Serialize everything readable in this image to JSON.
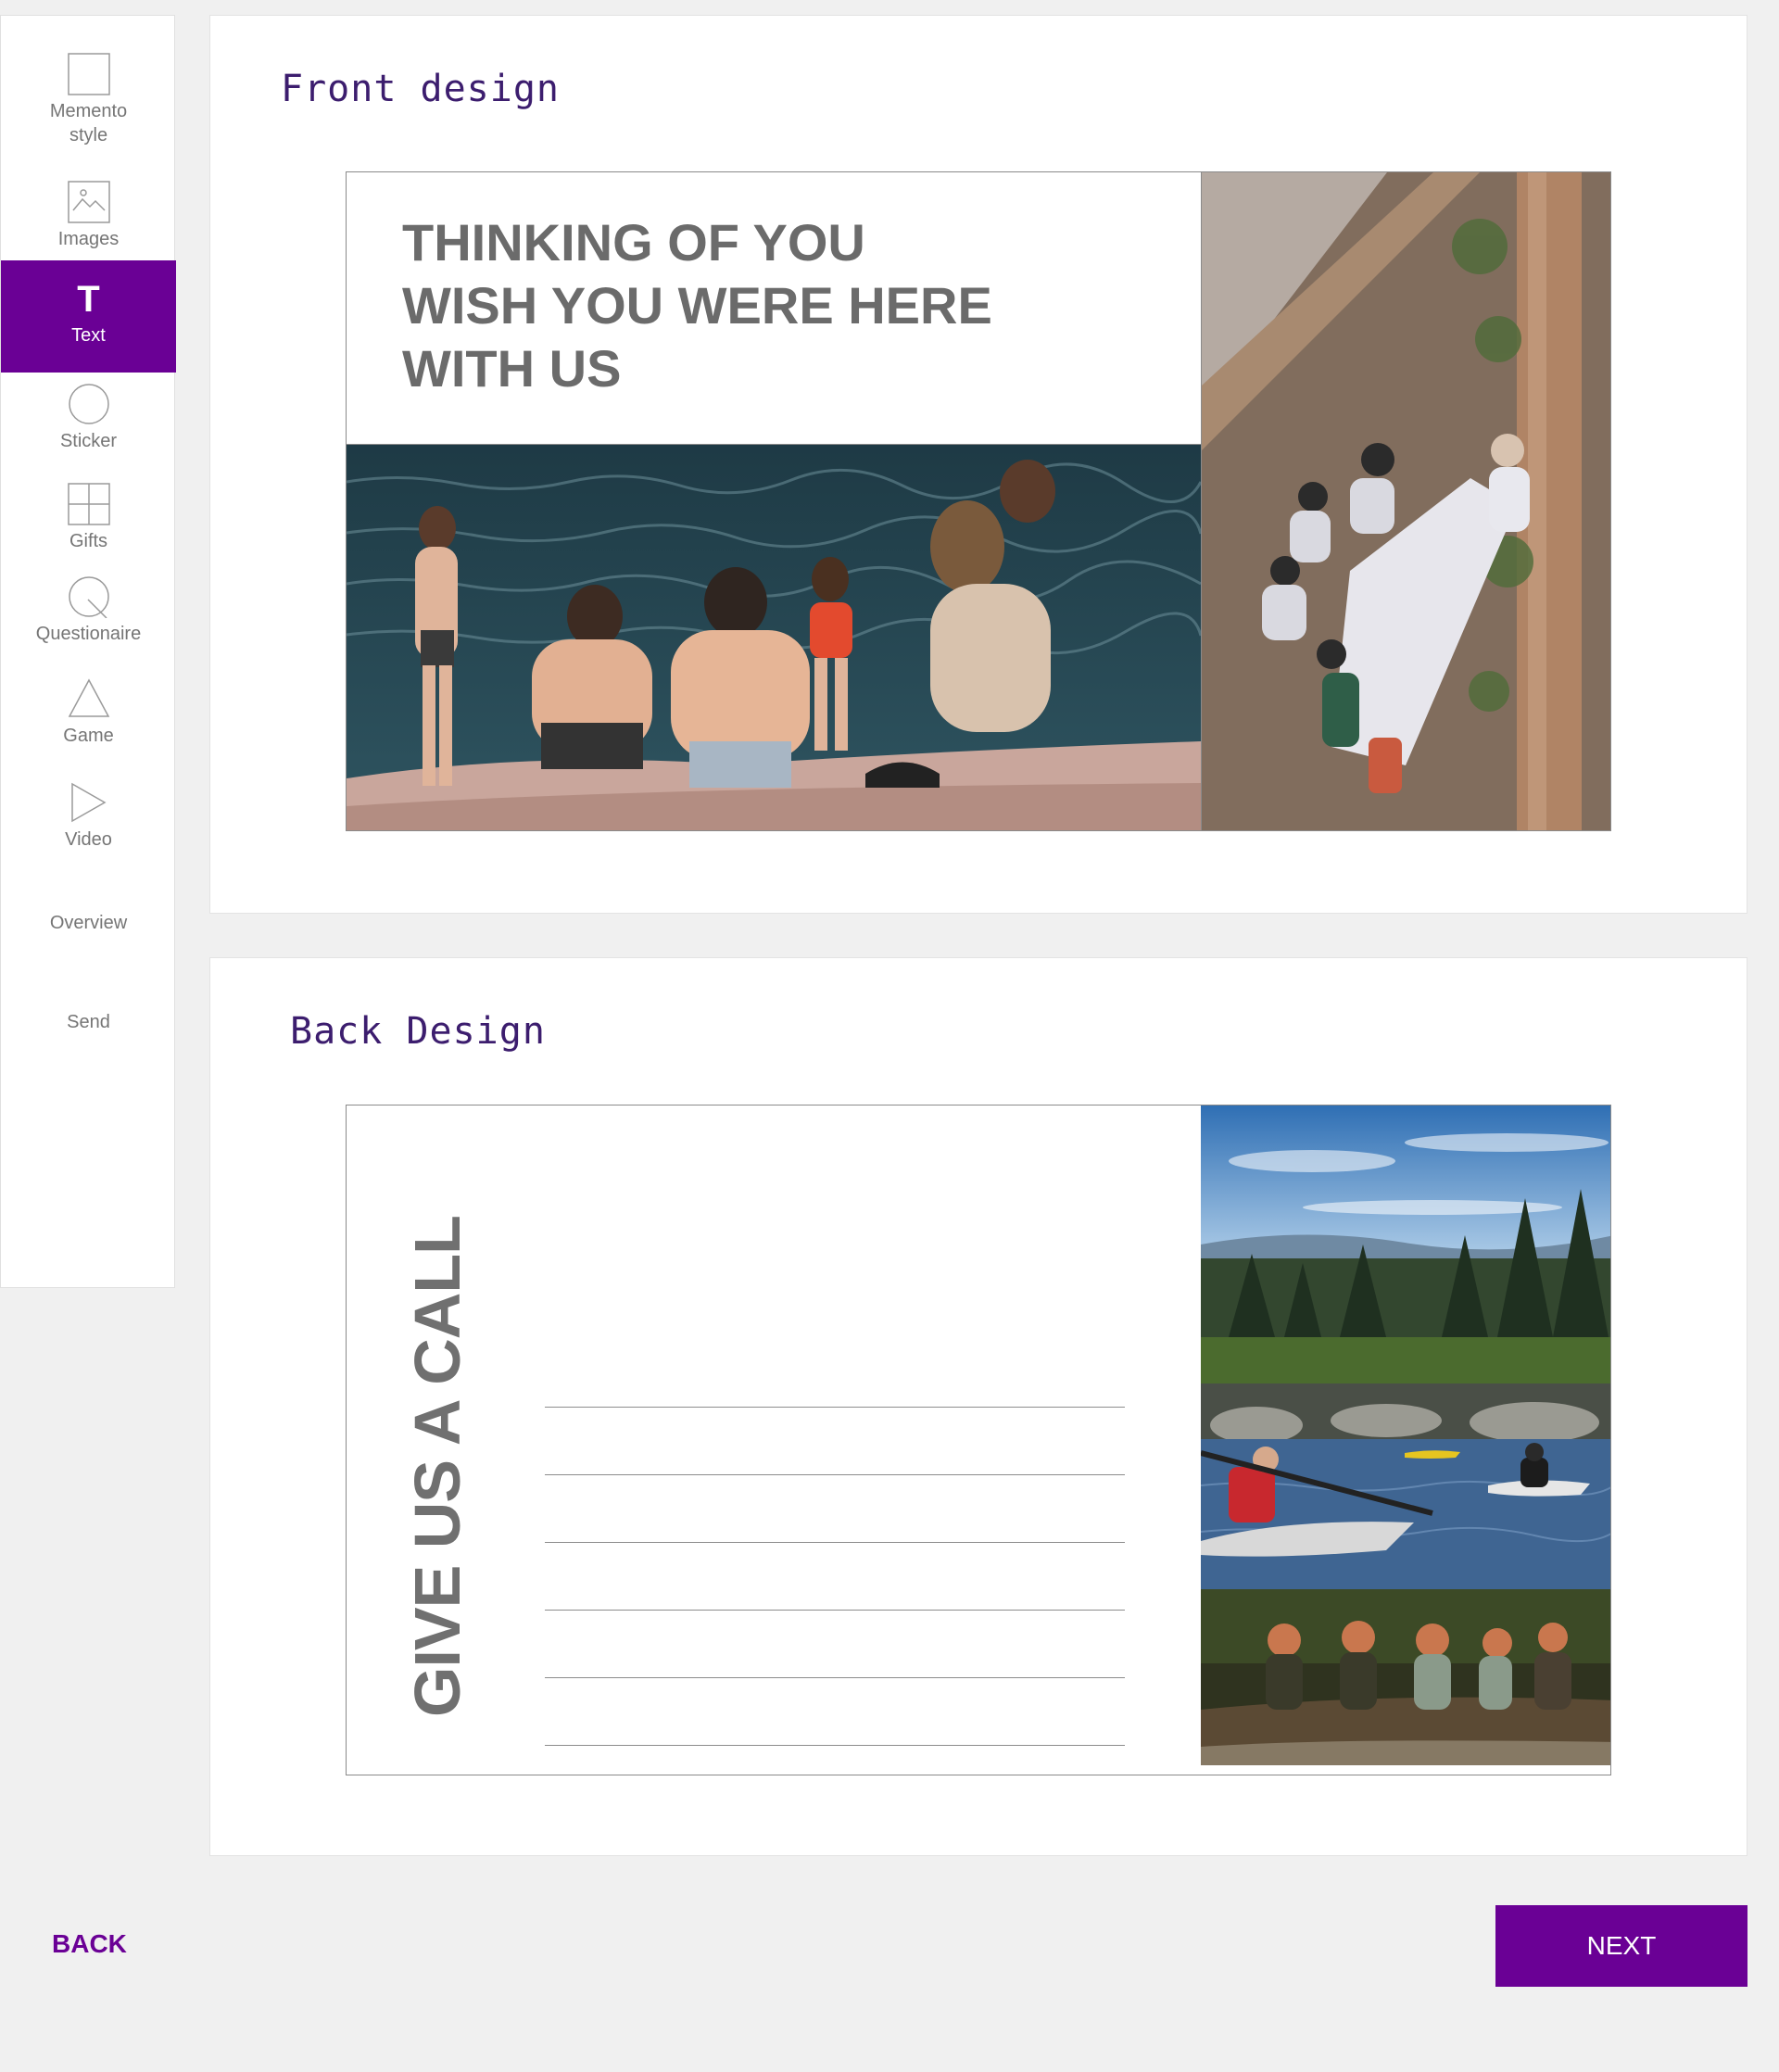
{
  "sidebar": {
    "items": [
      {
        "line1": "Memento",
        "line2": "style",
        "icon": "square-icon"
      },
      {
        "label": "Images",
        "icon": "image-icon"
      },
      {
        "label": "Text",
        "icon": "text-icon",
        "active": true
      },
      {
        "label": "Sticker",
        "icon": "circle-icon"
      },
      {
        "label": "Gifts",
        "icon": "grid-icon"
      },
      {
        "label": "Questionaire",
        "icon": "magnifier-icon"
      },
      {
        "label": "Game",
        "icon": "triangle-icon"
      },
      {
        "label": "Video",
        "icon": "play-icon"
      },
      {
        "label": "Overview"
      },
      {
        "label": "Send"
      }
    ],
    "text_icon_glyph": "T"
  },
  "front": {
    "title": "Front design",
    "lines": [
      "THINKING OF YOU",
      "WISH YOU WERE HERE",
      "WITH US"
    ],
    "photos": [
      "friends-on-rocks-by-lake-photo",
      "family-dinner-under-pergola-photo"
    ]
  },
  "back": {
    "title": "Back Design",
    "vertical_text": "GIVE US A CALL",
    "photos": [
      "mountain-forest-landscape-photo",
      "kayakers-on-lake-photo",
      "friends-sitting-on-log-photo"
    ]
  },
  "footer": {
    "back_label": "BACK",
    "next_label": "NEXT"
  },
  "colors": {
    "accent": "#6a0095",
    "title": "#3c1d6e",
    "card_text": "#6b6b6b"
  }
}
